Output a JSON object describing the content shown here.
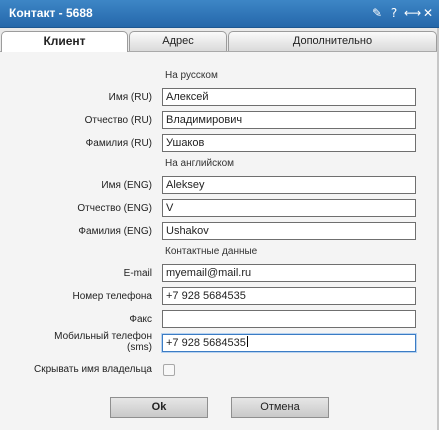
{
  "window": {
    "title": "Контакт - 5688"
  },
  "title_icons": [
    {
      "name": "pin-icon",
      "glyph": "✎"
    },
    {
      "name": "help-icon",
      "glyph": "?"
    },
    {
      "name": "resize-icon",
      "glyph": "⟷"
    },
    {
      "name": "close-icon",
      "glyph": "✕"
    }
  ],
  "tabs": [
    {
      "label": "Клиент",
      "active": true
    },
    {
      "label": "Адрес",
      "active": false
    },
    {
      "label": "Дополнительно",
      "active": false
    }
  ],
  "sections": {
    "russian": "На русском",
    "english": "На английском",
    "contacts": "Контактные данные"
  },
  "fields": {
    "first_name_ru": {
      "label": "Имя (RU)",
      "value": "Алексей"
    },
    "patronymic_ru": {
      "label": "Отчество (RU)",
      "value": "Владимирович"
    },
    "last_name_ru": {
      "label": "Фамилия (RU)",
      "value": "Ушаков"
    },
    "first_name_en": {
      "label": "Имя (ENG)",
      "value": "Aleksey"
    },
    "patronymic_en": {
      "label": "Отчество (ENG)",
      "value": "V"
    },
    "last_name_en": {
      "label": "Фамилия (ENG)",
      "value": "Ushakov"
    },
    "email": {
      "label": "E-mail",
      "value": "myemail@mail.ru"
    },
    "phone": {
      "label": "Номер телефона",
      "value": "+7 928 5684535"
    },
    "fax": {
      "label": "Факс",
      "value": ""
    },
    "mobile": {
      "label_line1": "Мобильный телефон",
      "label_line2": "(sms)",
      "value": "+7 928 5684535"
    }
  },
  "hide_owner": {
    "label": "Скрывать имя владельца",
    "checked": false
  },
  "buttons": {
    "ok": "Ok",
    "cancel": "Отмена"
  }
}
